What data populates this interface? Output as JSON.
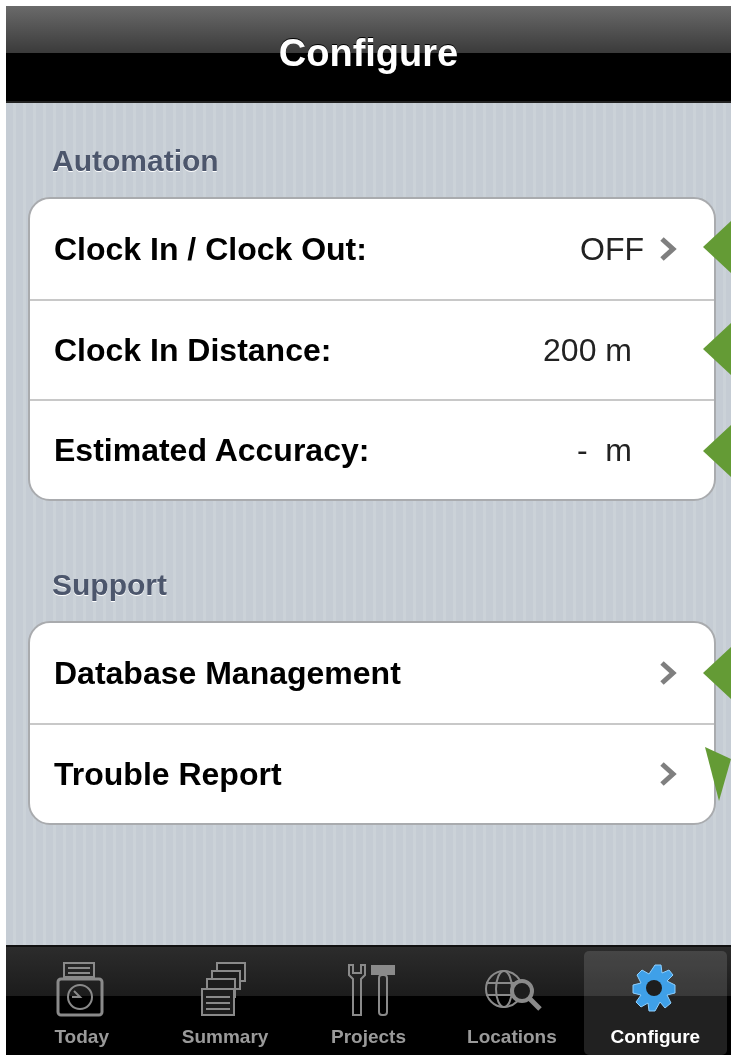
{
  "navbar": {
    "title": "Configure"
  },
  "sections": [
    {
      "header": "Automation",
      "rows": [
        {
          "label": "Clock In / Clock Out:",
          "value": "OFF",
          "disclosure": true
        },
        {
          "label": "Clock In Distance:",
          "value": "200 m",
          "disclosure": false
        },
        {
          "label": "Estimated Accuracy:",
          "value": "-  m",
          "disclosure": false
        }
      ]
    },
    {
      "header": "Support",
      "rows": [
        {
          "label": "Database Management",
          "disclosure": true
        },
        {
          "label": "Trouble Report",
          "disclosure": true
        }
      ]
    }
  ],
  "tabs": [
    {
      "label": "Today",
      "selected": false
    },
    {
      "label": "Summary",
      "selected": false
    },
    {
      "label": "Projects",
      "selected": false
    },
    {
      "label": "Locations",
      "selected": false
    },
    {
      "label": "Configure",
      "selected": true
    }
  ]
}
